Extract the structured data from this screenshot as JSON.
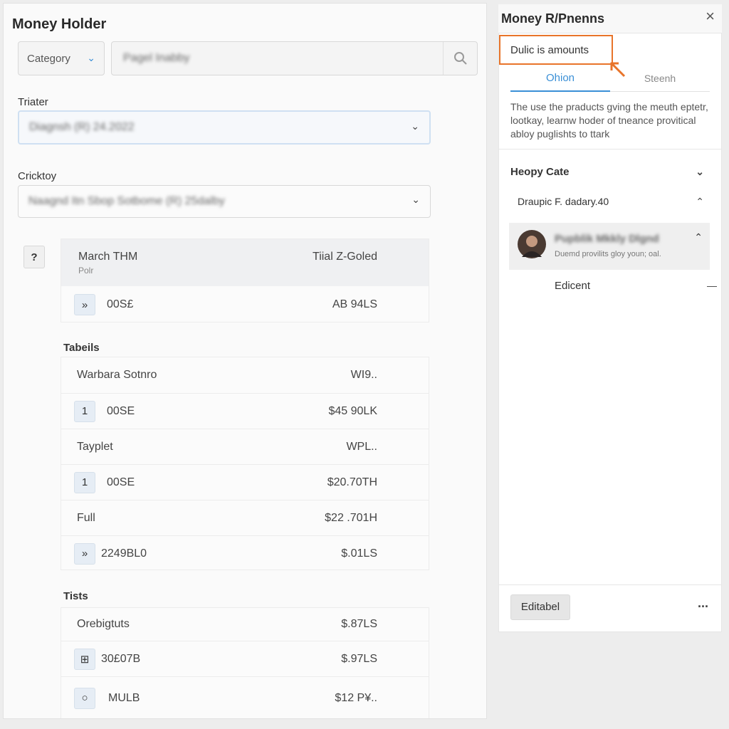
{
  "left": {
    "title": "Money Holder",
    "category_select": "Category",
    "search_placeholder": "Pagel Inabby",
    "filter1_label": "Triater",
    "filter1_value": "Diagnsh (R) 24.2022",
    "filter2_label": "Cricktoy",
    "filter2_value": "Naagnd Itn Sbop Sotbome (R) 25dalby",
    "help": "?",
    "summary": {
      "col1": "March THM",
      "col1_sub": "Polr",
      "col2": "Tiial Z-Goled",
      "row_badge": "»",
      "row_code": "00S£",
      "row_value": "AB 94LS"
    },
    "section1_title": "Tabeils",
    "section1_rows": [
      {
        "badge": "",
        "name": "Warbara Sotnro",
        "value": "WI9.."
      },
      {
        "badge": "1",
        "name": "00SE",
        "value": "$45 90LK"
      },
      {
        "badge": "",
        "name": "Tayplet",
        "value": "WPL.."
      },
      {
        "badge": "1",
        "name": "00SE",
        "value": "$20.70TH"
      },
      {
        "badge": "",
        "name": "Full",
        "value": "$22 .701H"
      },
      {
        "badge": "»",
        "name": "2249BL0",
        "value": "$.01LS"
      }
    ],
    "section2_title": "Tists",
    "section2_rows": [
      {
        "badge": "",
        "name": "Orebigtuts",
        "value": "$.87LS"
      },
      {
        "badge": "⊞",
        "name": "30£07B",
        "value": "$.97LS"
      },
      {
        "badge": "○",
        "name": "MULB",
        "value": "$12 P¥.."
      }
    ]
  },
  "right": {
    "title": "Money R/Pnenns",
    "close": "×",
    "tooltip": "Dulic is amounts",
    "tabs": [
      "Ohion",
      "Steenh"
    ],
    "description": "The use the praducts gving the meuth eptetr, lootkay, learnw hoder of tneance provitical abloy puglishts to ttark",
    "section_title": "Heopy Cate",
    "sub_row": "Draupic F. dadary.40",
    "person_name": "Pupblik Mkkly Dlgnd",
    "person_desc": "Duemd provilits gloy youn; oal.",
    "edit_row": "Edicent",
    "edit_button": "Editabel",
    "more": "...",
    "accent": "#e8742a",
    "link": "#3a8fd6"
  }
}
